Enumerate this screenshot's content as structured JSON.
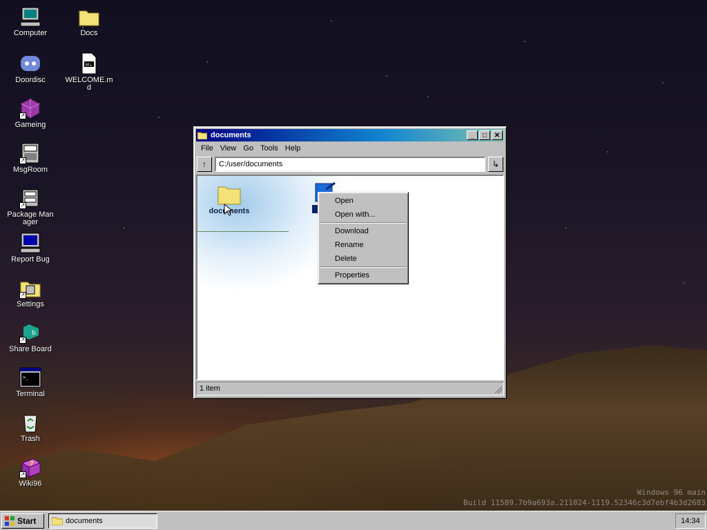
{
  "desktop": {
    "icons": [
      {
        "label": "Computer",
        "icon": "computer-icon"
      },
      {
        "label": "Docs",
        "icon": "folder-icon"
      },
      {
        "label": "Doordisc",
        "icon": "chat-icon"
      },
      {
        "label": "WELCOME.md",
        "icon": "markdown-file-icon"
      },
      {
        "label": "Gameing",
        "icon": "game-cube-icon"
      },
      {
        "label": "MsgRoom",
        "icon": "message-room-icon"
      },
      {
        "label": "Package Manager",
        "icon": "package-icon"
      },
      {
        "label": "Report Bug",
        "icon": "bug-report-icon"
      },
      {
        "label": "Settings",
        "icon": "settings-folder-icon"
      },
      {
        "label": "Share Board",
        "icon": "share-board-icon"
      },
      {
        "label": "Terminal",
        "icon": "terminal-icon"
      },
      {
        "label": "Trash",
        "icon": "recycle-bin-icon"
      },
      {
        "label": "Wiki96",
        "icon": "help-book-icon"
      }
    ],
    "watermark": {
      "line1": "Windows 96 main",
      "line2": "Build 11589.7b9a693a.211024-1119.52346c3d7ebf4b3d2683"
    }
  },
  "window": {
    "title": "documents",
    "menu": [
      "File",
      "View",
      "Go",
      "Tools",
      "Help"
    ],
    "address": "C:/user/documents",
    "items": [
      {
        "label": "documents",
        "icon": "folder-icon"
      },
      {
        "label": "C",
        "icon": "app-file-icon"
      }
    ],
    "status": "1 item"
  },
  "context_menu": {
    "open": "Open",
    "open_with": "Open with...",
    "download": "Download",
    "rename": "Rename",
    "delete": "Delete",
    "properties": "Properties"
  },
  "taskbar": {
    "start": "Start",
    "task": "documents",
    "clock": "14:34"
  },
  "colors": {
    "titlebar_start": "#000080",
    "titlebar_end": "#1084d0",
    "face": "#c0c0c0",
    "selection": "#0a246a"
  }
}
